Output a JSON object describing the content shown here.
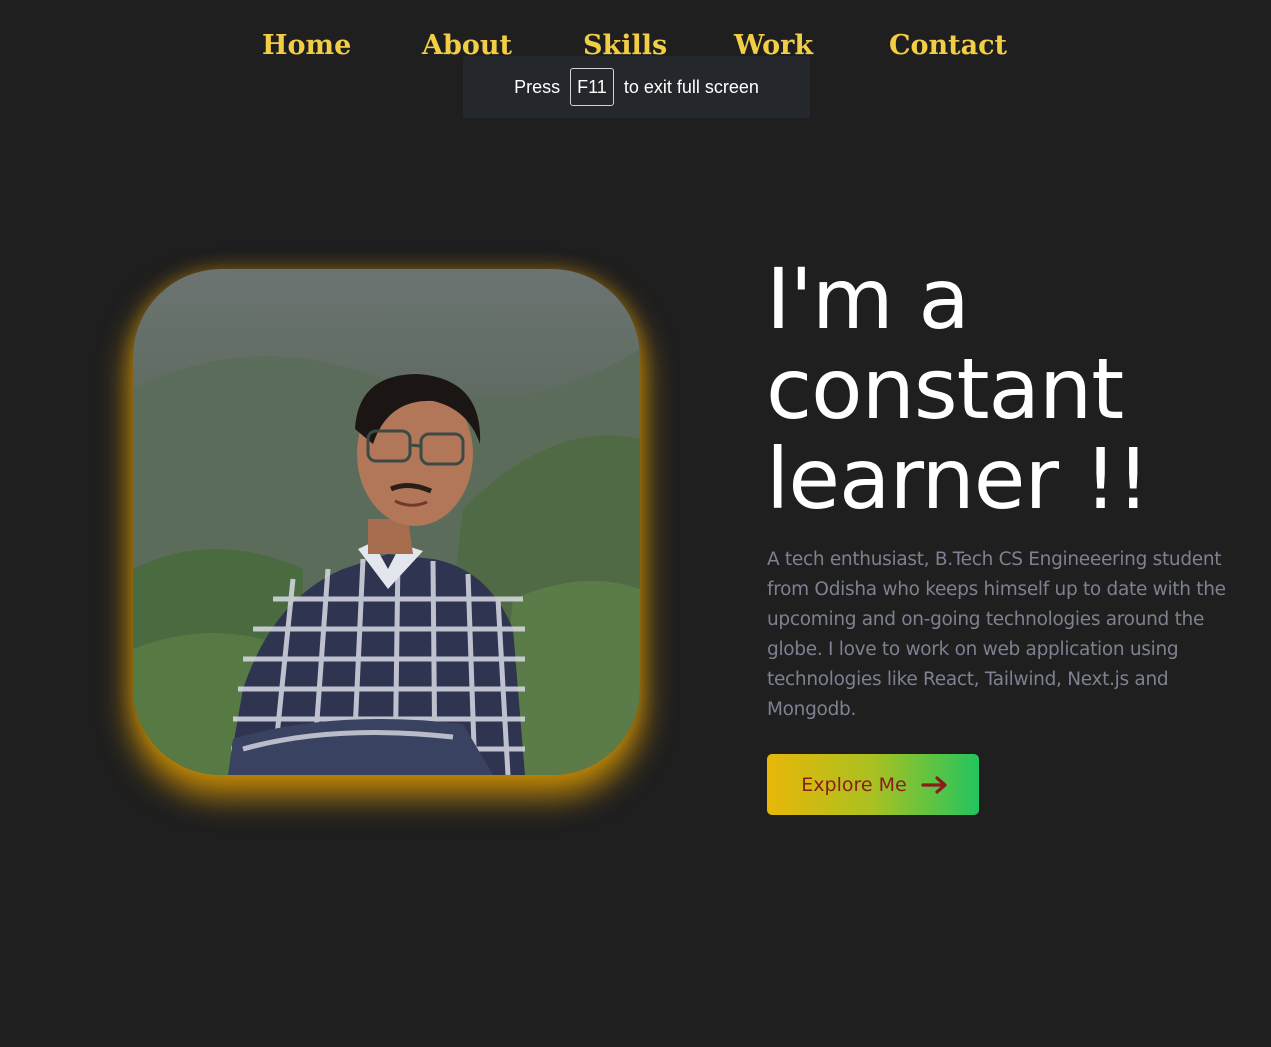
{
  "nav": {
    "items": [
      {
        "label": "Home"
      },
      {
        "label": "About"
      },
      {
        "label": "Skills"
      },
      {
        "label": "Work"
      },
      {
        "label": "Contact"
      }
    ]
  },
  "fullscreen_toast": {
    "prefix": "Press",
    "key": "F11",
    "suffix": "to exit full screen"
  },
  "hero": {
    "title": "I'm a constant learner !!",
    "description": "A tech enthusiast, B.Tech CS Engineeering student from Odisha who keeps himself up to date with the upcoming and on-going technologies around the globe. I love to work on web application using technologies like React, Tailwind, Next.js and Mongodb.",
    "cta_label": "Explore Me",
    "cta_icon": "arrow-right-icon"
  },
  "colors": {
    "background": "#1f1f1f",
    "nav_text": "#f2cd46",
    "title_text": "#ffffff",
    "body_text": "#7d8190",
    "photo_glow": "#e6a000",
    "cta_gradient_start": "#e8b708",
    "cta_gradient_end": "#22c55e",
    "cta_text": "#8b1c1c"
  }
}
